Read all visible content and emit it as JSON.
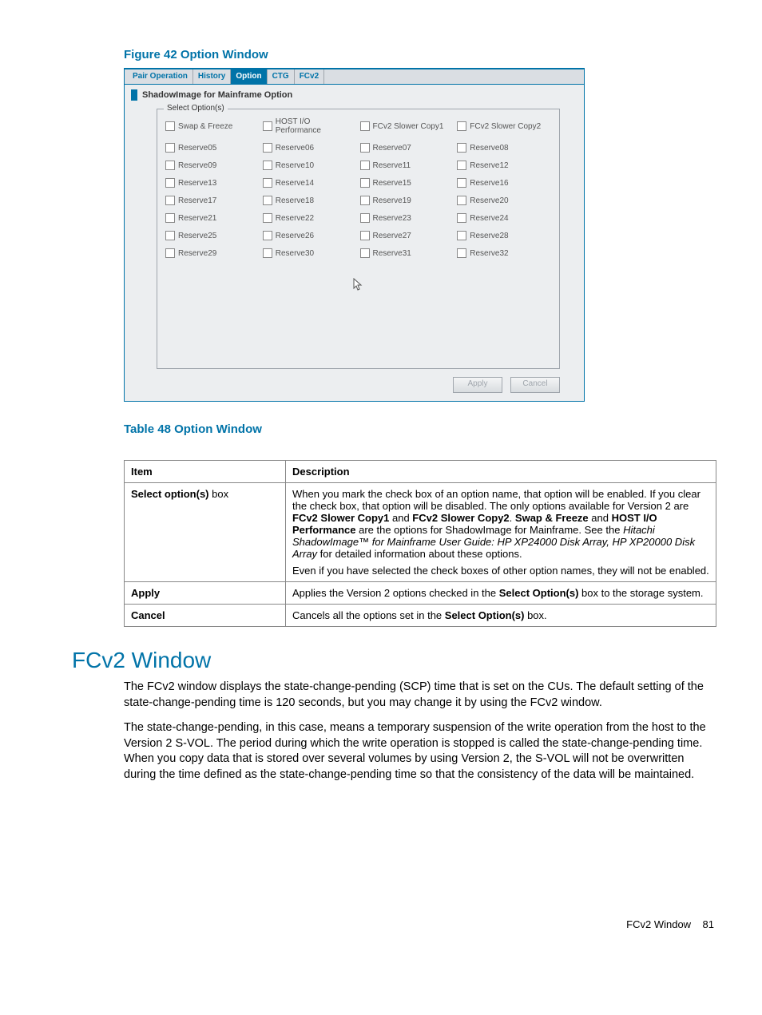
{
  "figure_caption": "Figure 42 Option Window",
  "app": {
    "tabs": [
      "Pair Operation",
      "History",
      "Option",
      "CTG",
      "FCv2"
    ],
    "active_tab_index": 2,
    "section_title": "ShadowImage for Mainframe Option",
    "fieldset_legend": "Select Option(s)",
    "options": [
      "Swap & Freeze",
      "HOST I/O Performance",
      "FCv2 Slower Copy1",
      "FCv2 Slower Copy2",
      "Reserve05",
      "Reserve06",
      "Reserve07",
      "Reserve08",
      "Reserve09",
      "Reserve10",
      "Reserve11",
      "Reserve12",
      "Reserve13",
      "Reserve14",
      "Reserve15",
      "Reserve16",
      "Reserve17",
      "Reserve18",
      "Reserve19",
      "Reserve20",
      "Reserve21",
      "Reserve22",
      "Reserve23",
      "Reserve24",
      "Reserve25",
      "Reserve26",
      "Reserve27",
      "Reserve28",
      "Reserve29",
      "Reserve30",
      "Reserve31",
      "Reserve32"
    ],
    "apply_label": "Apply",
    "cancel_label": "Cancel"
  },
  "table_caption": "Table 48 Option Window",
  "table": {
    "headers": [
      "Item",
      "Description"
    ],
    "rows": [
      {
        "item_html": "<span class='b'>Select option(s)</span> box",
        "desc_html": "When you mark the check box of an option name, that option will be enabled. If you clear the check box, that option will be disabled. The only options available for Version 2 are <span class='b'>FCv2 Slower Copy1</span> and <span class='b'>FCv2 Slower Copy2</span>. <span class='b'>Swap &amp; Freeze</span> and <span class='b'>HOST I/O Performance</span> are the options for ShadowImage for Mainframe. See the <span class='i'>Hitachi ShadowImage™ for Mainframe User Guide: HP XP24000 Disk Array, HP XP20000 Disk Array</span> for detailed information about these options.<span class='segspace'></span>Even if you have selected the check boxes of other option names, they will not be enabled."
      },
      {
        "item_html": "<span class='b'>Apply</span>",
        "desc_html": "Applies the Version 2 options checked in the <span class='b'>Select Option(s)</span> box to the storage system."
      },
      {
        "item_html": "<span class='b'>Cancel</span>",
        "desc_html": "Cancels all the options set in the <span class='b'>Select Option(s)</span> box."
      }
    ]
  },
  "heading": "FCv2 Window",
  "para1": "The FCv2 window displays the state-change-pending (SCP) time that is set on the CUs. The default setting of the state-change-pending time is 120 seconds, but you may change it by using the FCv2 window.",
  "para2": "The state-change-pending, in this case, means a temporary suspension of the write operation from the host to the Version 2 S-VOL. The period during which the write operation is stopped is called the state-change-pending time. When you copy data that is stored over several volumes by using Version 2, the S-VOL will not be overwritten during the time defined as the state-change-pending time so that the consistency of the data will be maintained.",
  "footer_label": "FCv2 Window",
  "footer_page": "81"
}
